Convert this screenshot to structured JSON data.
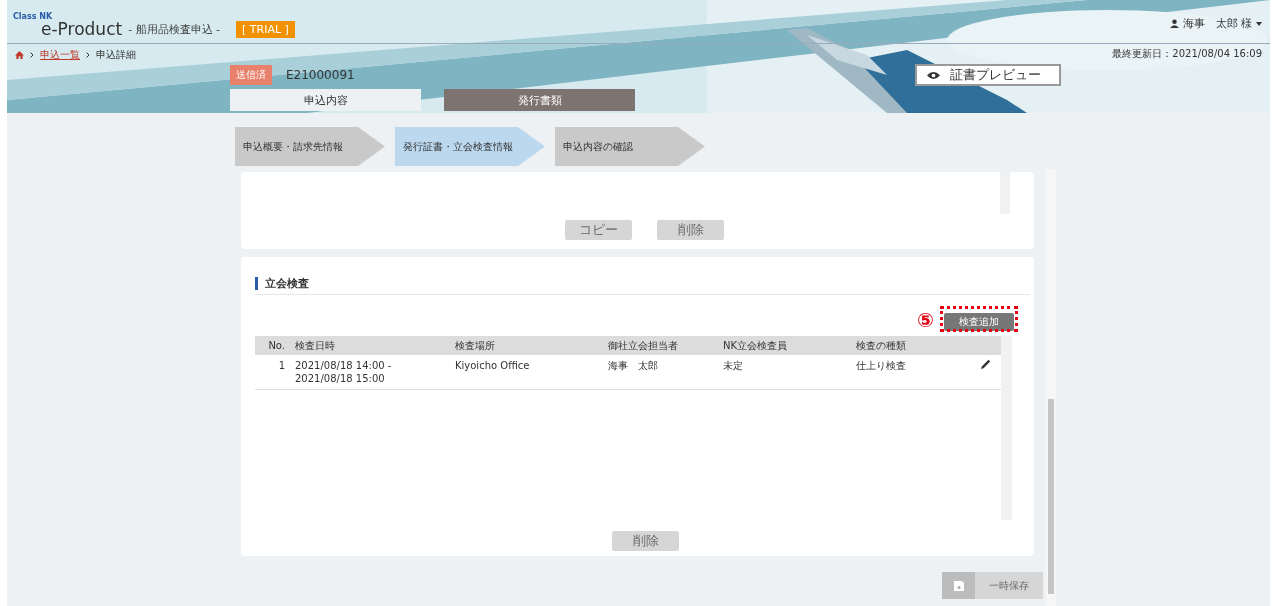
{
  "header": {
    "brand": "Class NK",
    "product": "e-Product",
    "subtitle": "- 船用品検査申込 -",
    "badge": "[ TRIAL ]",
    "user": "海事　太郎 様"
  },
  "breadcrumb": {
    "items": [
      {
        "label": "申込一覧",
        "kind": "link"
      },
      {
        "label": "申込詳細",
        "kind": "current"
      }
    ]
  },
  "last_updated": "最終更新日：2021/08/04 16:09",
  "application": {
    "status": "送信済",
    "number": "E21000091",
    "preview_button": "証書プレビュー"
  },
  "tabs": [
    {
      "label": "申込内容",
      "selected": true
    },
    {
      "label": "発行書類",
      "selected": false
    }
  ],
  "steps": [
    {
      "label": "申込概要・請求先情報",
      "selected": false
    },
    {
      "label": "発行証書・立会検査情報",
      "selected": true
    },
    {
      "label": "申込内容の確認",
      "selected": false
    }
  ],
  "top_card": {
    "buttons": [
      {
        "label": "コピー",
        "disabled": true
      },
      {
        "label": "削除",
        "disabled": true
      }
    ]
  },
  "inspection": {
    "title": "立会検査",
    "add_button": "検査追加",
    "callout": "⑤",
    "table": {
      "columns": [
        "No.",
        "検査日時",
        "検査場所",
        "御社立会担当者",
        "NK立会検査員",
        "検査の種類"
      ],
      "rows": [
        {
          "cells": [
            "1",
            "2021/08/18 14:00 -\n2021/08/18 15:00",
            "Kiyoicho Office",
            "海事　太郎",
            "未定",
            "仕上り検査"
          ]
        }
      ]
    },
    "delete_button": {
      "label": "削除",
      "disabled": true
    }
  },
  "save_button": {
    "label": "一時保存",
    "disabled": true
  }
}
